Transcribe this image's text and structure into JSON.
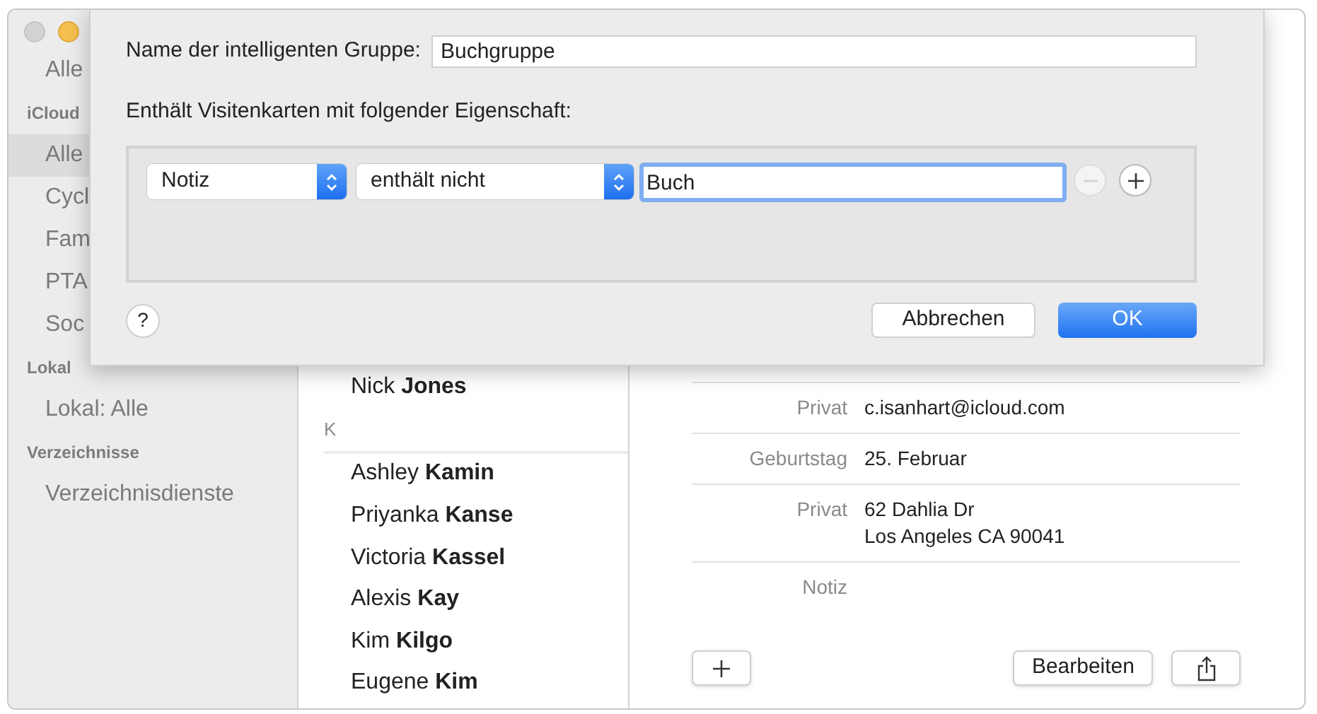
{
  "sidebar": {
    "entries": [
      {
        "kind": "item",
        "label": "Alle",
        "selected": false
      },
      {
        "kind": "header",
        "label": "iCloud"
      },
      {
        "kind": "item",
        "label": "Alle",
        "selected": true
      },
      {
        "kind": "item",
        "label": "Cycl",
        "selected": false
      },
      {
        "kind": "item",
        "label": "Fam",
        "selected": false
      },
      {
        "kind": "item",
        "label": "PTA",
        "selected": false
      },
      {
        "kind": "item",
        "label": "Soc",
        "selected": false
      },
      {
        "kind": "header",
        "label": "Lokal"
      },
      {
        "kind": "item",
        "label": "Lokal: Alle",
        "selected": false
      },
      {
        "kind": "header",
        "label": "Verzeichnisse"
      },
      {
        "kind": "item",
        "label": "Verzeichnisdienste",
        "selected": false
      }
    ]
  },
  "contacts": [
    {
      "kind": "contact",
      "first": "Nick",
      "last": "Jones"
    },
    {
      "kind": "letter",
      "label": "K"
    },
    {
      "kind": "contact",
      "first": "Ashley",
      "last": "Kamin"
    },
    {
      "kind": "contact",
      "first": "Priyanka",
      "last": "Kanse"
    },
    {
      "kind": "contact",
      "first": "Victoria",
      "last": "Kassel"
    },
    {
      "kind": "contact",
      "first": "Alexis",
      "last": "Kay"
    },
    {
      "kind": "contact",
      "first": "Kim",
      "last": "Kilgo"
    },
    {
      "kind": "contact",
      "first": "Eugene",
      "last": "Kim"
    }
  ],
  "detail": {
    "fields": [
      {
        "label": "Privat",
        "lines": [
          "c.isanhart@icloud.com"
        ]
      },
      {
        "label": "Geburtstag",
        "lines": [
          "25. Februar"
        ]
      },
      {
        "label": "Privat",
        "lines": [
          "62 Dahlia Dr",
          "Los Angeles CA 90041"
        ]
      },
      {
        "label": "Notiz"
      }
    ],
    "buttons": {
      "edit": "Bearbeiten"
    }
  },
  "dialog": {
    "name_label": "Name der intelligenten Gruppe:",
    "name_value": "Buchgruppe",
    "condition_label": "Enthält Visitenkarten mit folgender Eigenschaft:",
    "rule": {
      "property": "Notiz",
      "operator": "enthält nicht",
      "value": "Buch",
      "remove_disabled": true
    },
    "help": "?",
    "cancel": "Abbrechen",
    "ok": "OK"
  }
}
